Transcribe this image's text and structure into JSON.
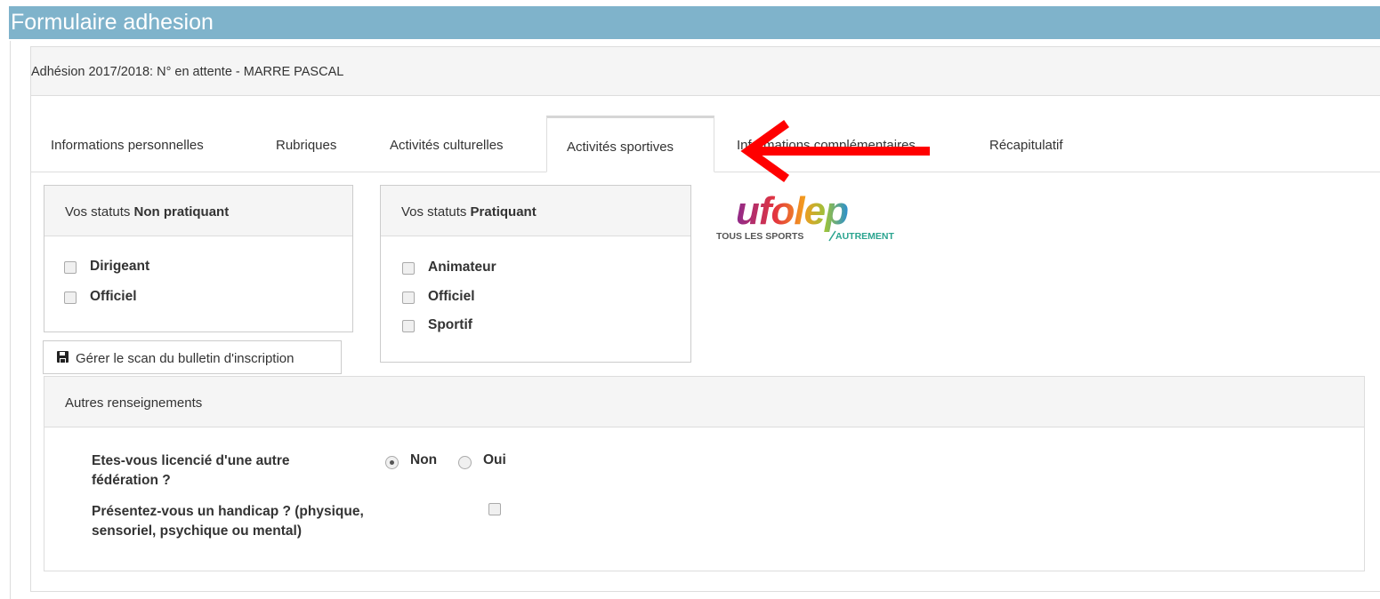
{
  "window": {
    "title": "Formulaire adhesion"
  },
  "heading": {
    "text": "Adhésion 2017/2018: N° en attente - MARRE PASCAL"
  },
  "tabs": [
    {
      "label": "Informations personnelles",
      "active": false
    },
    {
      "label": "Rubriques",
      "active": false
    },
    {
      "label": "Activités culturelles",
      "active": false
    },
    {
      "label": "Activités sportives",
      "active": true
    },
    {
      "label": "Informations complémentaires",
      "active": false
    },
    {
      "label": "Récapitulatif",
      "active": false
    }
  ],
  "non_pratiquant": {
    "title_prefix": "Vos statuts ",
    "title_bold": "Non pratiquant",
    "items": [
      {
        "label": "Dirigeant",
        "checked": false
      },
      {
        "label": "Officiel",
        "checked": false
      }
    ]
  },
  "pratiquant": {
    "title_prefix": "Vos statuts ",
    "title_bold": "Pratiquant",
    "items": [
      {
        "label": "Animateur",
        "checked": false
      },
      {
        "label": "Officiel",
        "checked": false
      },
      {
        "label": "Sportif",
        "checked": false
      }
    ]
  },
  "logo": {
    "word": "ufolep",
    "tagline_left": "TOUS LES SPORTS",
    "tagline_right": "AUTREMENT"
  },
  "scan_button": {
    "label": "Gérer le scan du bulletin d'inscription",
    "icon": "floppy-disk-icon"
  },
  "autres": {
    "title": "Autres renseignements",
    "q1": {
      "line1": "Etes-vous licencié d'une autre",
      "line2": "fédération ?",
      "options": [
        "Non",
        "Oui"
      ],
      "selected": "Non"
    },
    "q2": {
      "line1": "Présentez-vous un handicap ? (physique,",
      "line2": "sensoriel, psychique ou mental)",
      "checked": false
    }
  },
  "colors": {
    "title_bar": "#7fb3cb",
    "arrow": "#ff0000"
  }
}
